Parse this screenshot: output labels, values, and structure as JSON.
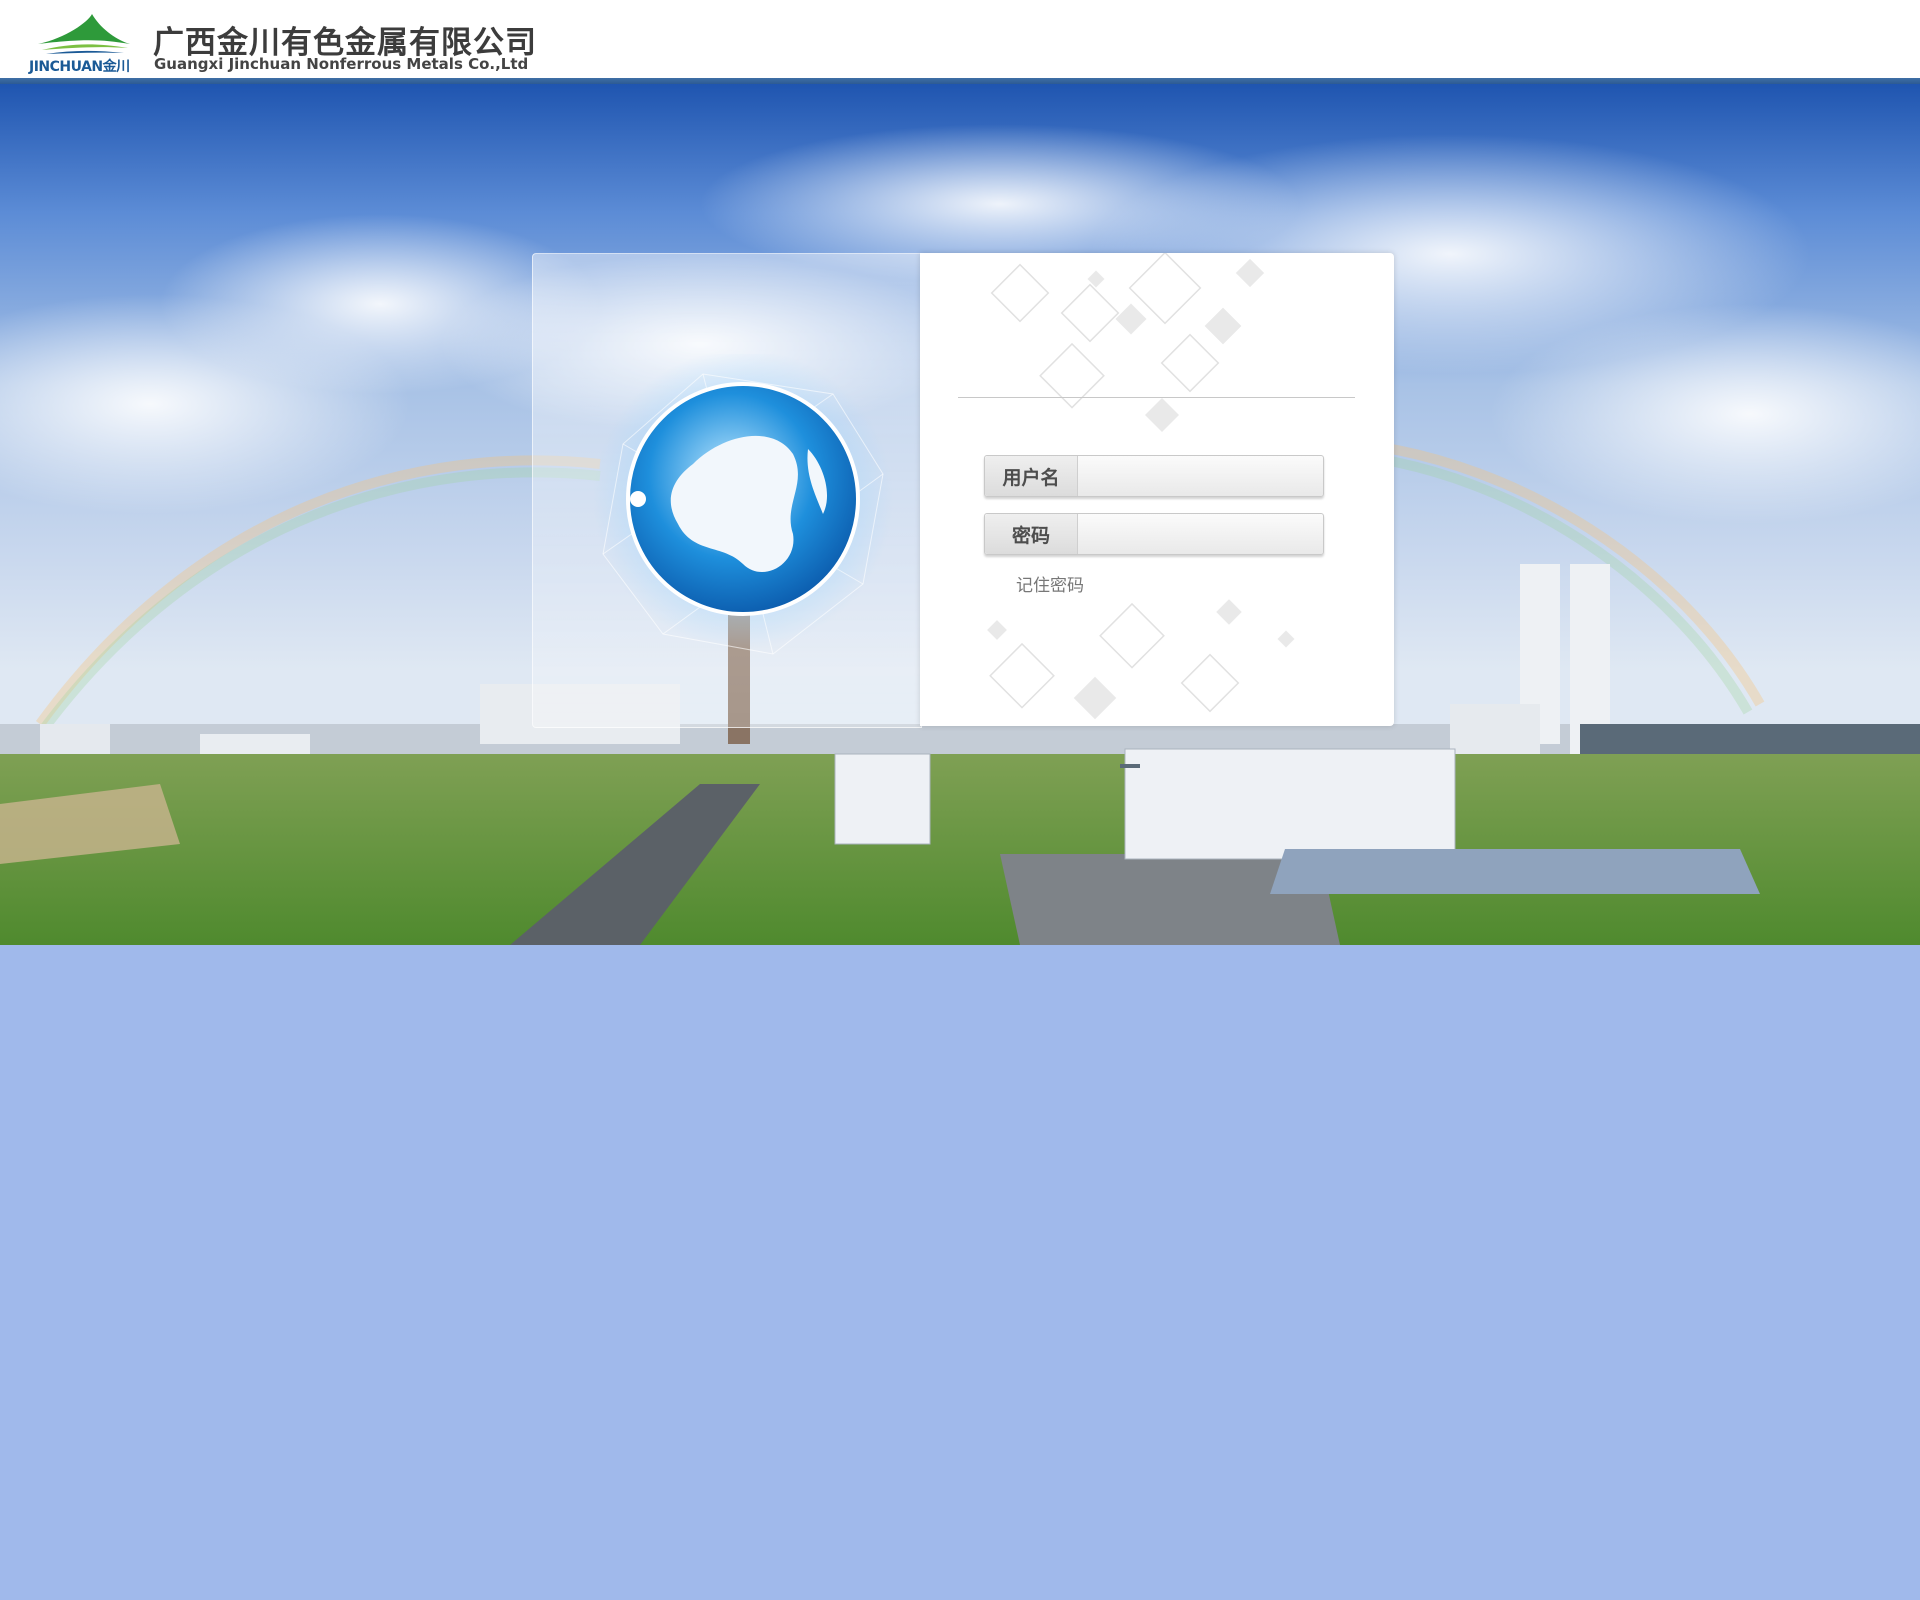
{
  "header": {
    "logo_small": "JINCHUAN金川",
    "company_cn": "广西金川有色金属有限公司",
    "company_en": "Guangxi Jinchuan Nonferrous Metals Co.,Ltd"
  },
  "login": {
    "username_label": "用户名",
    "username_value": "",
    "password_label": "密码",
    "password_value": "",
    "remember_label": "记住密码"
  },
  "colors": {
    "page_background": "#a0b9eb",
    "header_bar": "#2c5a93",
    "logo_green": "#2e9a3a",
    "logo_blue": "#1b5a96"
  },
  "icons": [
    "company-logo-icon",
    "globe-icon"
  ]
}
